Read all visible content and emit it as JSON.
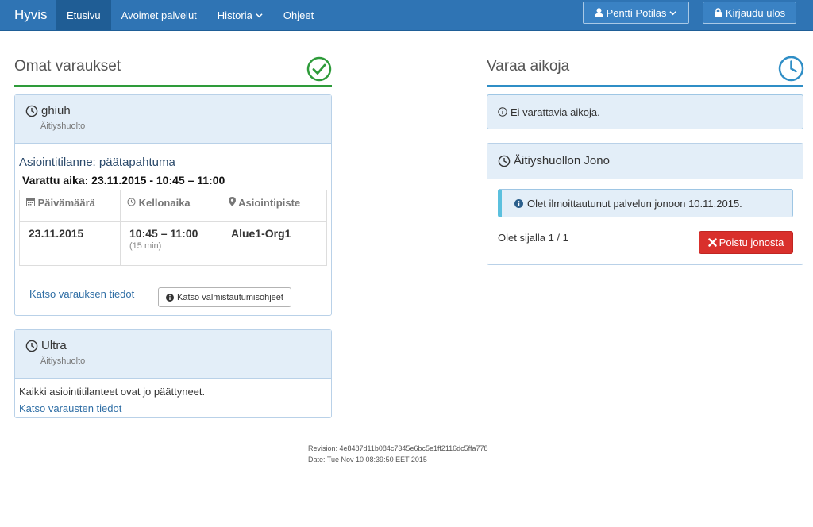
{
  "nav": {
    "brand": "Hyvis",
    "items": [
      "Etusivu",
      "Avoimet palvelut",
      "Historia",
      "Ohjeet"
    ],
    "user": "Pentti Potilas",
    "logout": "Kirjaudu ulos"
  },
  "left": {
    "title": "Omat varaukset",
    "bookings": [
      {
        "title": "ghiuh",
        "service": "Äitiyshuolto",
        "status": "Asiointitilanne: päätapahtuma",
        "reserved": "Varattu aika: 23.11.2015 - 10:45 – 11:00",
        "columns": [
          "Päivämäärä",
          "Kellonaika",
          "Asiointipiste"
        ],
        "date": "23.11.2015",
        "time": "10:45 – 11:00",
        "duration": "(15 min)",
        "location": "Alue1-Org1",
        "details_link": "Katso varauksen tiedot",
        "prep_button": "Katso valmistautumisohjeet"
      },
      {
        "title": "Ultra",
        "service": "Äitiyshuolto",
        "message": "Kaikki asiointitilanteet ovat jo päättyneet.",
        "details_link": "Katso varausten tiedot"
      }
    ]
  },
  "right": {
    "title": "Varaa aikoja",
    "no_times": "Ei varattavia aikoja.",
    "queue": {
      "title": "Äitiyshuollon Jono",
      "notice": "Olet ilmoittautunut palvelun jonoon 10.11.2015.",
      "position": "Olet sijalla 1 / 1",
      "leave_button": "Poistu jonosta"
    }
  },
  "footer": {
    "revision": "Revision: 4e8487d11b084c7345e6bc5e1ff2116dc5ffa778",
    "date": "Date: Tue Nov 10 08:39:50 EET 2015"
  },
  "colors": {
    "navbar": "#2f74b4",
    "success": "#2e9b3a",
    "primary": "#2f8ec6",
    "danger": "#d9302c"
  }
}
